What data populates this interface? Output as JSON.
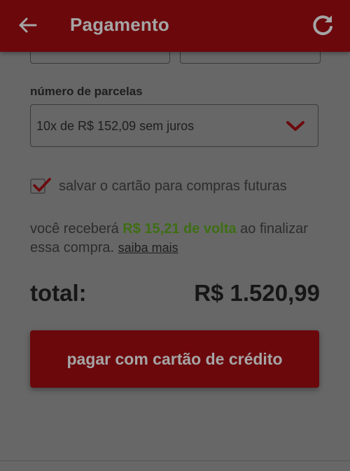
{
  "header": {
    "title": "Pagamento",
    "back_icon": "arrow-left-icon",
    "refresh_icon": "refresh-icon"
  },
  "installments": {
    "label": "número de parcelas",
    "selected": "10x de R$ 152,09 sem juros",
    "dropdown_icon": "chevron-down-icon"
  },
  "save_card": {
    "checked": true,
    "label": "salvar o cartão para compras futuras"
  },
  "cashback": {
    "prefix": "você receberá ",
    "amount": "R$ 15,21 de volta",
    "suffix": " ao finalizar essa compra. ",
    "link_label": "saiba mais"
  },
  "total": {
    "label": "total:",
    "value": "R$ 1.520,99"
  },
  "pay_button": {
    "label": "pagar com cartão de crédito"
  },
  "colors": {
    "brand": "#e10f19",
    "cashback_green": "#6ec72a",
    "overlay_background": "#676767"
  }
}
